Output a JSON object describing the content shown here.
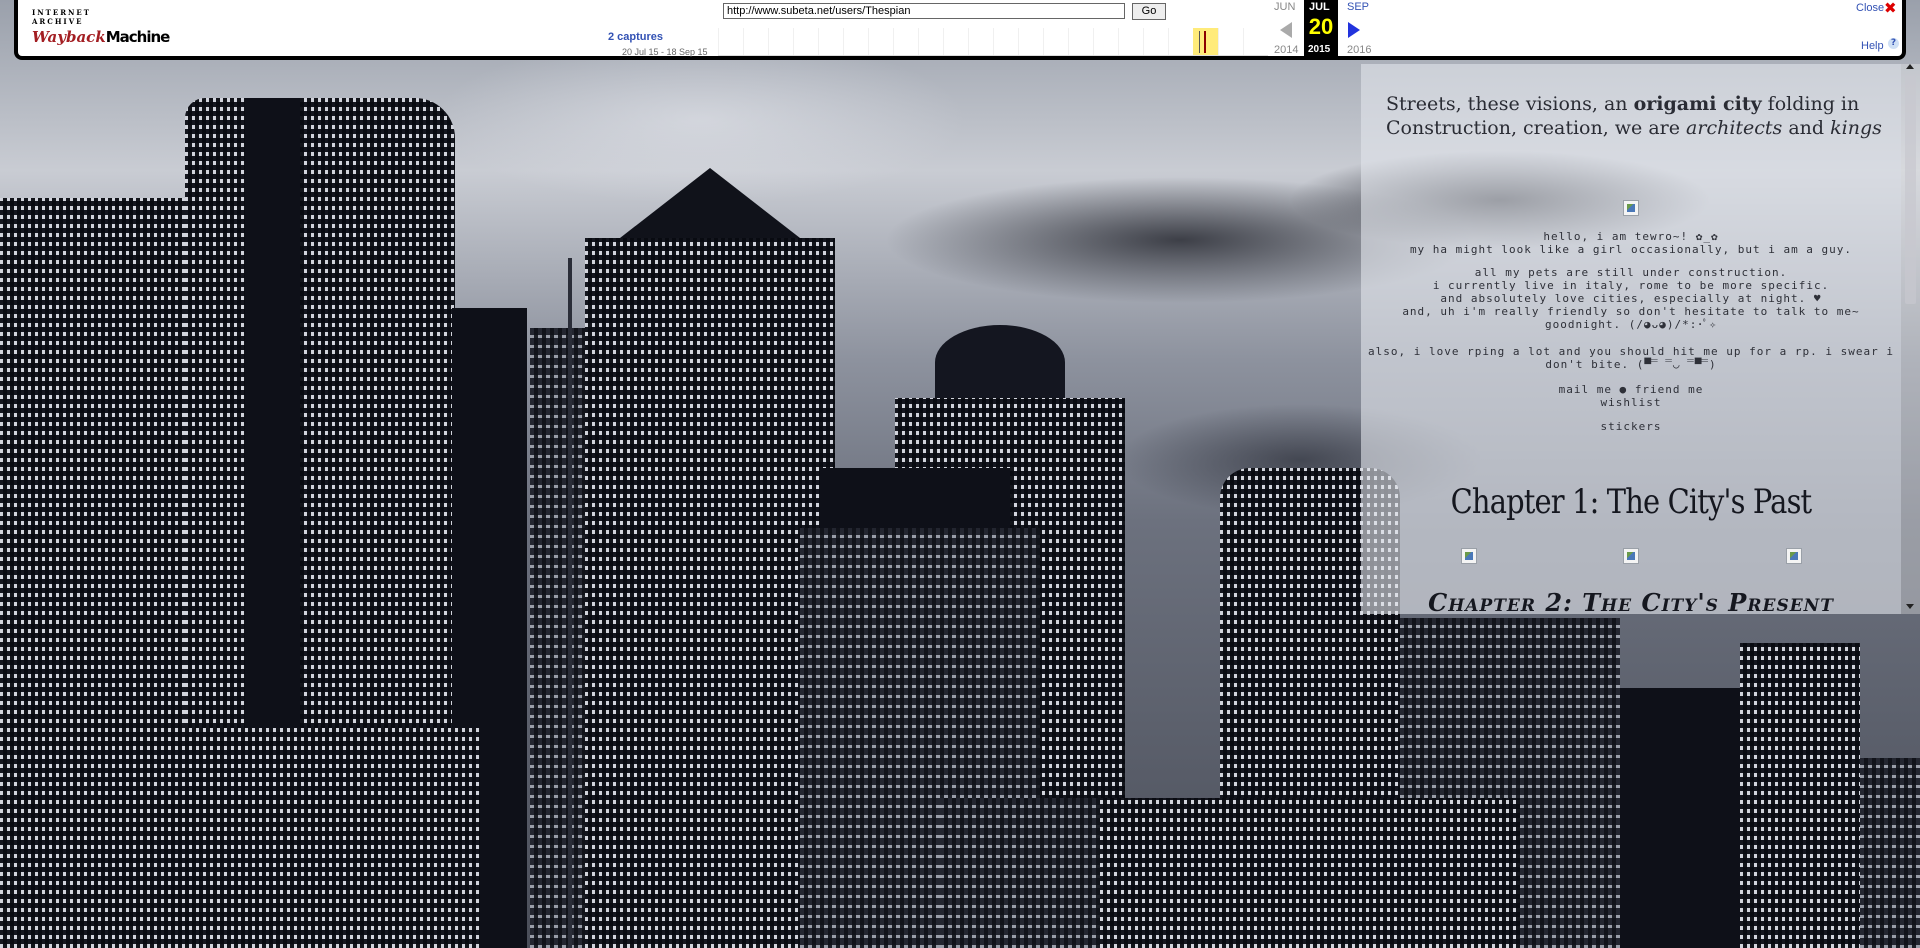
{
  "wayback": {
    "logo_top": "INTERNET ARCHIVE",
    "logo_way": "Wayback",
    "logo_machine": "Machine",
    "url": "http://www.subeta.net/users/Thespian",
    "go_label": "Go",
    "captures": "2 captures",
    "capture_range": "20 Jul 15 - 18 Sep 15",
    "prev_month": "JUN",
    "prev_year": "2014",
    "cur_month": "JUL",
    "cur_day": "20",
    "cur_year": "2015",
    "next_month": "SEP",
    "next_year": "2016",
    "close_label": "Close",
    "help_label": "Help",
    "accent_color": "#3352b4",
    "icons": [
      "left-arrow-icon",
      "right-arrow-icon",
      "close-icon",
      "help-icon"
    ]
  },
  "profile": {
    "lyrics_1a": "Streets, these visions, an ",
    "lyrics_1b": "origami city",
    "lyrics_1c": " folding in",
    "lyrics_2a": "Construction, creation, we are ",
    "lyrics_2b": "architects",
    "lyrics_2c": " and ",
    "lyrics_2d": "kings",
    "bio_1": "hello, i am tewro~! ✿_✿",
    "bio_2": "my ha might look like a girl occasionally, but i am a guy.",
    "bio_3": "all my pets are still under construction.",
    "bio_4": "i currently live in italy, rome to be more specific.",
    "bio_5": "and absolutely love cities, especially at night. ♥",
    "bio_6": "and, uh i'm really friendly so don't hesitate to talk to me~",
    "bio_7": "goodnight. (/◕ᴗ◕)/*:･ﾟ✧",
    "bio_8": "also, i love rping a lot and you should hit me up for a rp. i swear i",
    "bio_9": "don't bite. (▀̿ ̿◡ ̿▀̿)",
    "link_mail": "mail me",
    "link_sep": " ● ",
    "link_friend": "friend me",
    "link_wishlist": "wishlist",
    "link_stickers": "stickers",
    "chapter1": "Chapter 1: The City's Past",
    "chapter2": "Chapter 2: The City's Present"
  }
}
